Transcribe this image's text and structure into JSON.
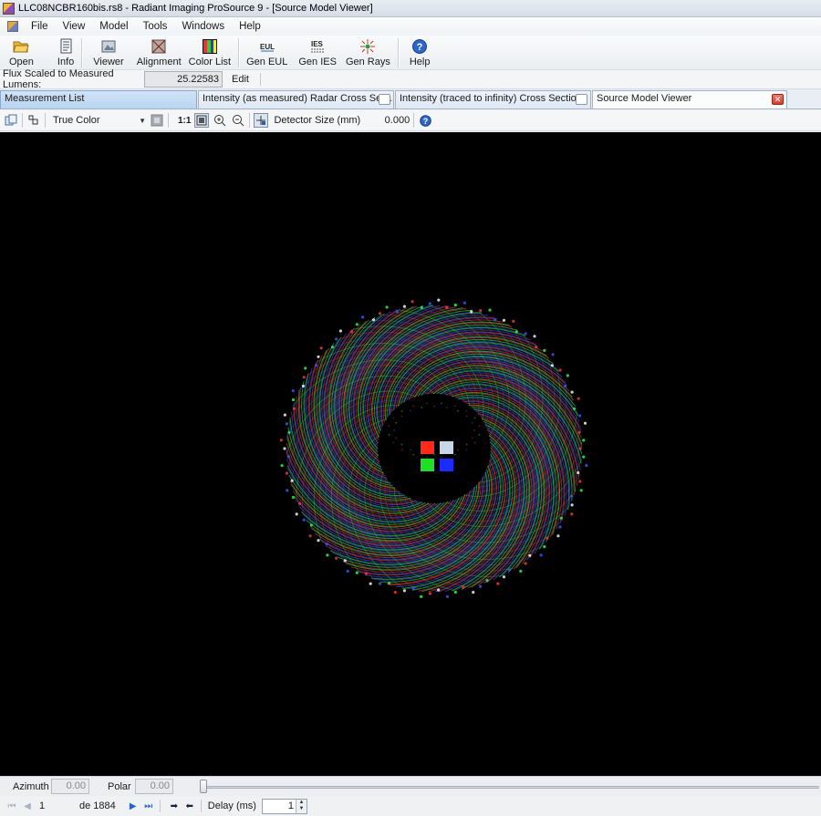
{
  "window": {
    "title": "LLC08NCBR160bis.rs8 - Radiant Imaging ProSource 9 - [Source Model Viewer]"
  },
  "menu": [
    "File",
    "View",
    "Model",
    "Tools",
    "Windows",
    "Help"
  ],
  "toolbar": {
    "items": [
      {
        "label": "Open",
        "icon": "folder-open-icon"
      },
      {
        "label": "Info",
        "icon": "document-info-icon"
      },
      {
        "label": "Viewer",
        "icon": "viewer-icon"
      },
      {
        "label": "Alignment",
        "icon": "alignment-icon"
      },
      {
        "label": "Color List",
        "icon": "color-list-icon"
      },
      {
        "label": "Gen EUL",
        "icon": "gen-eul-icon"
      },
      {
        "label": "Gen IES",
        "icon": "gen-ies-icon"
      },
      {
        "label": "Gen Rays",
        "icon": "gen-rays-icon"
      },
      {
        "label": "Help",
        "icon": "help-icon"
      }
    ]
  },
  "flux": {
    "label": "Flux Scaled to Measured Lumens:",
    "value": "25.22583",
    "edit_label": "Edit"
  },
  "tabs": [
    {
      "label": "Measurement List"
    },
    {
      "label": "Intensity (as measured) Radar Cross Sect..."
    },
    {
      "label": "Intensity (traced to infinity) Cross Section"
    },
    {
      "label": "Source Model Viewer"
    }
  ],
  "viewer_toolbar": {
    "color_mode": "True Color",
    "ratio_label": "1:1",
    "detector_label": "Detector Size (mm)",
    "detector_value": "0.000"
  },
  "angles": {
    "azimuth_label": "Azimuth",
    "azimuth_value": "0.00",
    "polar_label": "Polar",
    "polar_value": "0.00"
  },
  "navigation": {
    "frame_value": "1",
    "frame_total": "de 1884",
    "delay_label": "Delay (ms)",
    "delay_value": "1"
  },
  "colors": {
    "canvas_bg": "#000000",
    "tab_active": "#c5dcf3",
    "close_red": "#d9402e"
  }
}
